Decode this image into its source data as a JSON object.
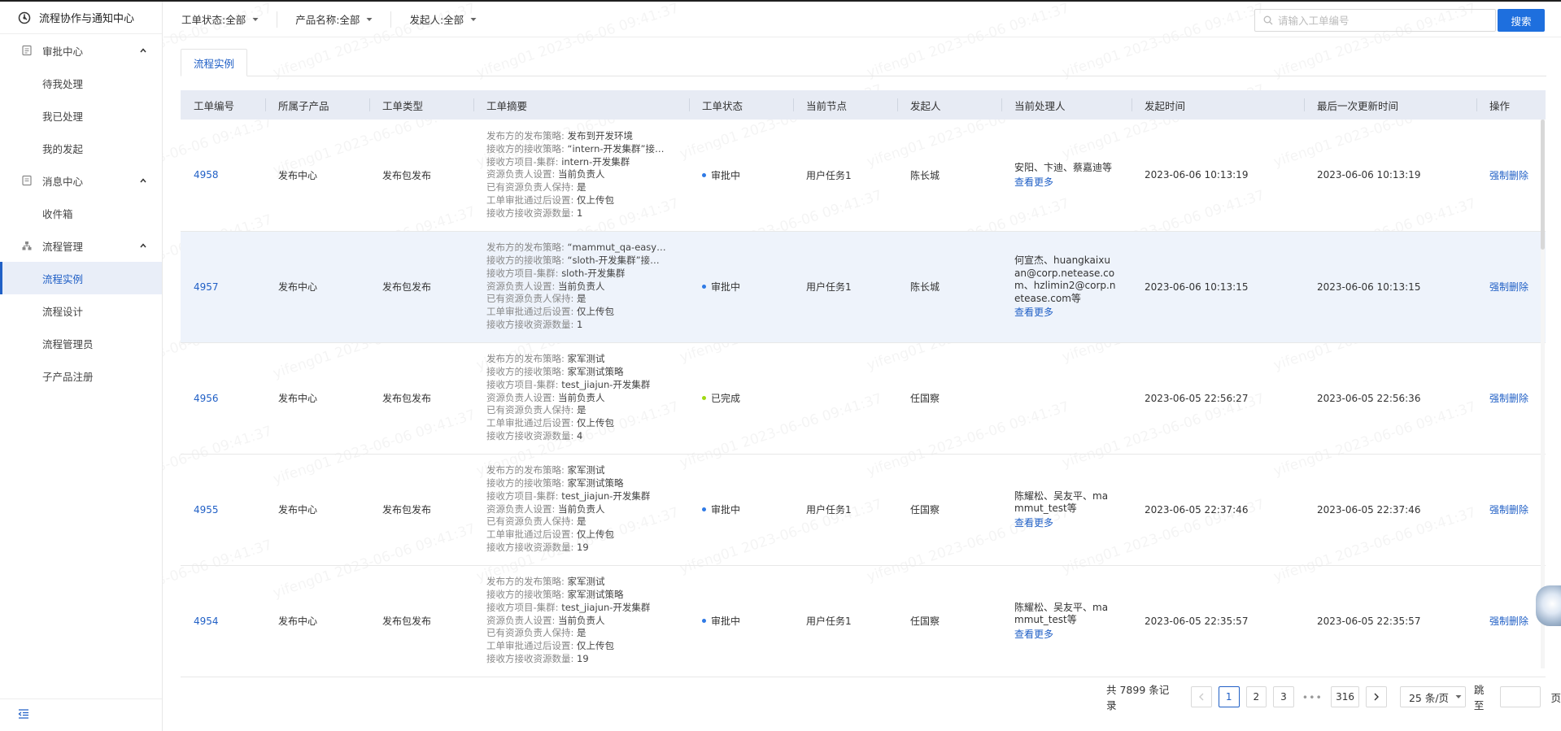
{
  "app": {
    "title": "流程协作与通知中心"
  },
  "sidebar": {
    "groups": [
      {
        "label": "审批中心",
        "items": [
          "待我处理",
          "我已处理",
          "我的发起"
        ]
      },
      {
        "label": "消息中心",
        "items": [
          "收件箱"
        ]
      },
      {
        "label": "流程管理",
        "items": [
          "流程实例",
          "流程设计",
          "流程管理员",
          "子产品注册"
        ]
      }
    ],
    "active_item": "流程实例"
  },
  "filters": [
    {
      "label": "工单状态:全部"
    },
    {
      "label": "产品名称:全部"
    },
    {
      "label": "发起人:全部"
    }
  ],
  "search": {
    "placeholder": "请输入工单编号",
    "button": "搜索"
  },
  "tabs": [
    {
      "label": "流程实例"
    }
  ],
  "table": {
    "columns": [
      "工单编号",
      "所属子产品",
      "工单类型",
      "工单摘要",
      "工单状态",
      "当前节点",
      "发起人",
      "当前处理人",
      "发起时间",
      "最后一次更新时间",
      "操作"
    ],
    "summary_keys": [
      "发布方的发布策略:",
      "接收方的接收策略:",
      "接收方项目-集群:",
      "资源负责人设置:",
      "已有资源负责人保持:",
      "工单审批通过后设置:",
      "接收方接收资源数量:"
    ],
    "rows": [
      {
        "id": "4958",
        "product": "发布中心",
        "type": "发布包发布",
        "summary": [
          "发布到开发环境",
          "“intern-开发集群”接…",
          "intern-开发集群",
          "当前负责人",
          "是",
          "仅上传包",
          "1"
        ],
        "status": "审批中",
        "node": "用户任务1",
        "initiator": "陈长城",
        "handlers": "安阳、卞迪、蔡嘉迪等",
        "more": "查看更多",
        "created": "2023-06-06 10:13:19",
        "updated": "2023-06-06 10:13:19",
        "action": "强制删除"
      },
      {
        "id": "4957",
        "product": "发布中心",
        "type": "发布包发布",
        "summary": [
          "“mammut_qa-easy…",
          "“sloth-开发集群”接…",
          "sloth-开发集群",
          "当前负责人",
          "是",
          "仅上传包",
          "1"
        ],
        "status": "审批中",
        "node": "用户任务1",
        "initiator": "陈长城",
        "handlers": "何宣杰、huangkaixuan@corp.netease.com、hzlimin2@corp.netease.com等",
        "more": "查看更多",
        "created": "2023-06-06 10:13:15",
        "updated": "2023-06-06 10:13:15",
        "action": "强制删除"
      },
      {
        "id": "4956",
        "product": "发布中心",
        "type": "发布包发布",
        "summary": [
          "家军测试",
          "家军测试策略",
          "test_jiajun-开发集群",
          "当前负责人",
          "是",
          "仅上传包",
          "4"
        ],
        "status": "已完成",
        "node": "",
        "initiator": "任国察",
        "handlers": "",
        "more": "",
        "created": "2023-06-05 22:56:27",
        "updated": "2023-06-05 22:56:36",
        "action": "强制删除"
      },
      {
        "id": "4955",
        "product": "发布中心",
        "type": "发布包发布",
        "summary": [
          "家军测试",
          "家军测试策略",
          "test_jiajun-开发集群",
          "当前负责人",
          "是",
          "仅上传包",
          "19"
        ],
        "status": "审批中",
        "node": "用户任务1",
        "initiator": "任国察",
        "handlers": "陈耀松、吴友平、mammut_test等",
        "more": "查看更多",
        "created": "2023-06-05 22:37:46",
        "updated": "2023-06-05 22:37:46",
        "action": "强制删除"
      },
      {
        "id": "4954",
        "product": "发布中心",
        "type": "发布包发布",
        "summary": [
          "家军测试",
          "家军测试策略",
          "test_jiajun-开发集群",
          "当前负责人",
          "是",
          "仅上传包",
          "19"
        ],
        "status": "审批中",
        "node": "用户任务1",
        "initiator": "任国察",
        "handlers": "陈耀松、吴友平、mammut_test等",
        "more": "查看更多",
        "created": "2023-06-05 22:35:57",
        "updated": "2023-06-05 22:35:57",
        "action": "强制删除"
      }
    ]
  },
  "pagination": {
    "total_text": "共 7899 条记录",
    "pages": [
      "1",
      "2",
      "3"
    ],
    "ellipsis": "•••",
    "last_page": "316",
    "page_size": "25 条/页",
    "jump_label": "跳至",
    "page_suffix": "页"
  },
  "watermark": "yifeng01 2023-06-06 09:41:37",
  "colors": {
    "primary": "#2160c6",
    "button": "#1e6fde",
    "status_pending": "#2f7ae5",
    "status_done": "#a0d911",
    "header_bg": "#e7ebf4",
    "highlight_row": "#eef3fb"
  }
}
